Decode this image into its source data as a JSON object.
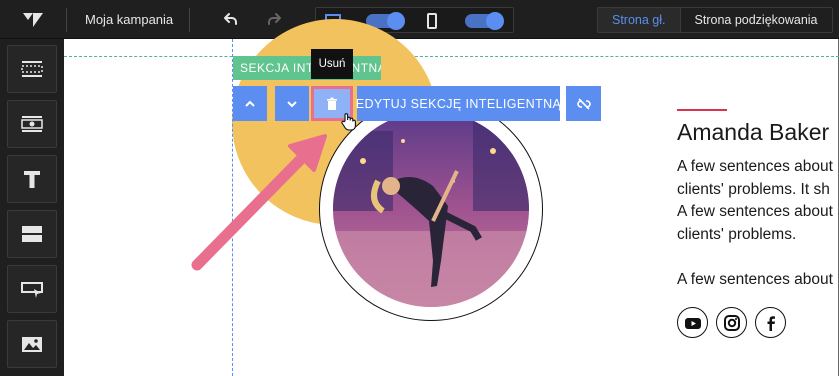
{
  "topbar": {
    "campaign_name": "Moja kampania",
    "logo_icon": "brand-logo",
    "undo_icon": "undo-icon",
    "redo_icon": "redo-icon",
    "desktop_view": {
      "icon": "desktop-icon",
      "enabled": true
    },
    "mobile_view": {
      "icon": "mobile-icon",
      "enabled": true
    },
    "page_tabs": [
      {
        "label": "Strona gł.",
        "active": true
      },
      {
        "label": "Strona podziękowania",
        "active": false
      }
    ]
  },
  "sidebar": {
    "items": [
      {
        "name": "section-layout-icon"
      },
      {
        "name": "smart-section-icon"
      },
      {
        "name": "text-icon"
      },
      {
        "name": "divider-blocks-icon"
      },
      {
        "name": "button-block-icon"
      },
      {
        "name": "image-icon"
      }
    ]
  },
  "canvas": {
    "section_label": "SEKCJA INTELIGENTNA",
    "tooltip": "Usuń",
    "toolbar": {
      "move_up_icon": "chevron-up-icon",
      "move_down_icon": "chevron-down-icon",
      "delete_icon": "trash-icon",
      "edit_label": "EDYTUJ SEKCJĘ INTELIGENTNĄ",
      "unlink_icon": "unlink-icon"
    },
    "profile": {
      "name": "Amanda Baker",
      "bio_lines": [
        "A few sentences about",
        "clients' problems. It sh",
        "A few sentences about",
        "clients' problems.",
        "A few sentences about"
      ],
      "socials": [
        "youtube-icon",
        "instagram-icon",
        "facebook-icon"
      ]
    }
  },
  "colors": {
    "accent_blue": "#5b8ef0",
    "section_green": "#5fc48d",
    "highlight_pink": "#e86f8e",
    "yellow": "#f2c25e",
    "name_underline": "#d9344d"
  }
}
